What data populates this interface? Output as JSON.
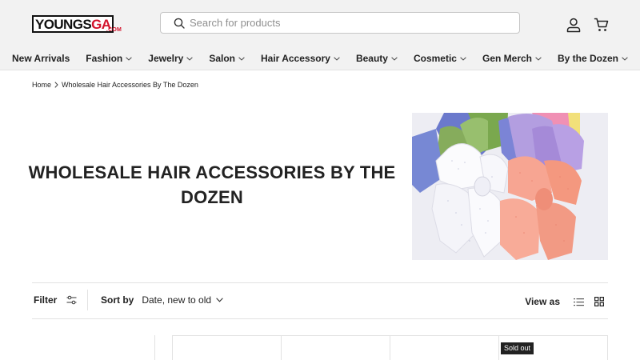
{
  "brand": {
    "logo_main": "YOUNGS",
    "logo_accent": "GA",
    "logo_sub": ".COM"
  },
  "search": {
    "placeholder": "Search for products"
  },
  "header_icons": [
    "account-icon",
    "cart-icon"
  ],
  "nav": {
    "items": [
      {
        "label": "New Arrivals",
        "dropdown": false
      },
      {
        "label": "Fashion",
        "dropdown": true
      },
      {
        "label": "Jewelry",
        "dropdown": true
      },
      {
        "label": "Salon",
        "dropdown": true
      },
      {
        "label": "Hair Accessory",
        "dropdown": true
      },
      {
        "label": "Beauty",
        "dropdown": true
      },
      {
        "label": "Cosmetic",
        "dropdown": true
      },
      {
        "label": "Gen Merch",
        "dropdown": true
      },
      {
        "label": "By the Dozen",
        "dropdown": true
      }
    ]
  },
  "breadcrumb": {
    "home": "Home",
    "current": "Wholesale Hair Accessories By The Dozen"
  },
  "collection": {
    "title": "WHOLESALE HAIR ACCESSORIES BY THE DOZEN",
    "image_alt": "Assorted colorful bow hair clips"
  },
  "toolbar": {
    "filter_label": "Filter",
    "sort_label": "Sort by",
    "sort_value": "Date, new to old",
    "view_label": "View as"
  },
  "products": {
    "badges": [
      "",
      "",
      "",
      "Sold out"
    ]
  },
  "colors": {
    "header_bg": "#f2f2f2",
    "accent": "#d3132c",
    "text": "#222222",
    "border": "#e2e2e2"
  }
}
